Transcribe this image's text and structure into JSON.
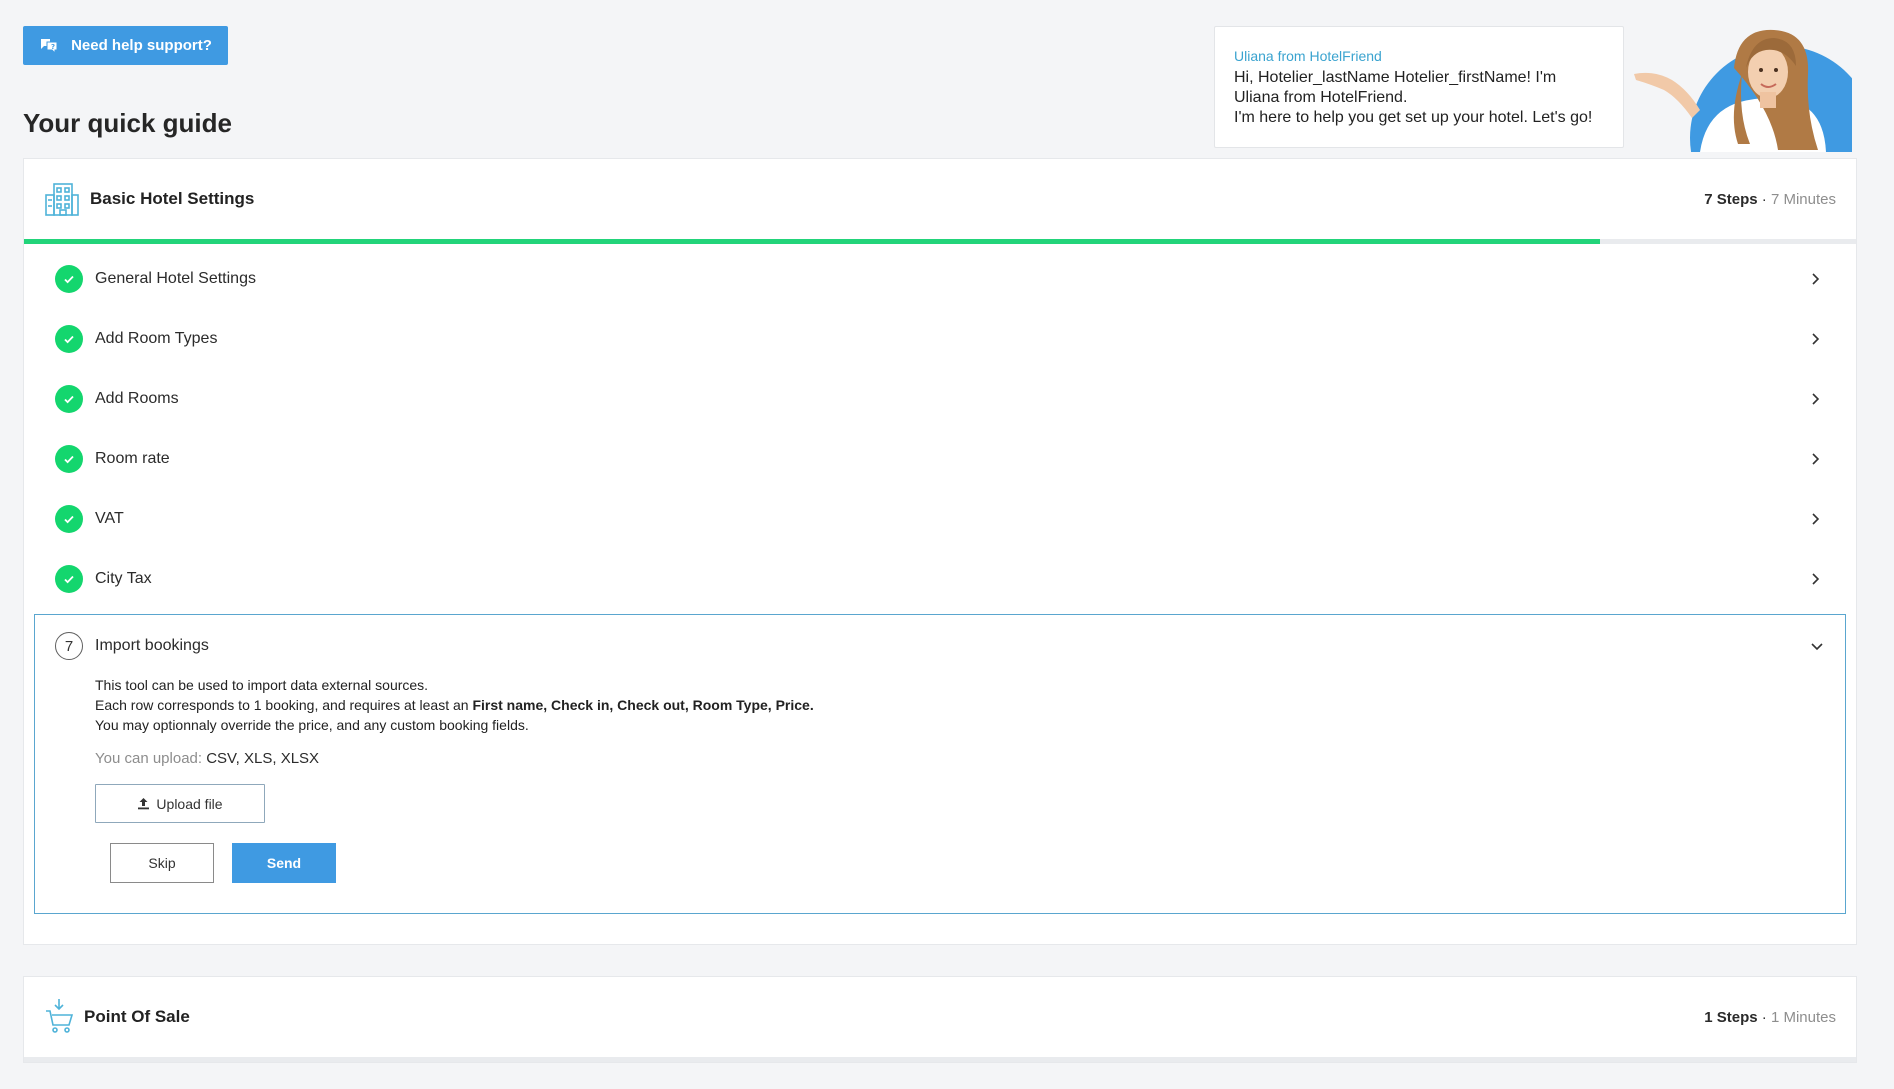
{
  "header": {
    "help_button_label": "Need help support?",
    "page_title": "Your quick guide"
  },
  "chat": {
    "sender": "Uliana from HotelFriend",
    "lines": [
      "Hi, Hotelier_lastName Hotelier_firstName! I'm",
      "Uliana from HotelFriend.",
      "I'm here to help you get set up your hotel. Let's go!"
    ]
  },
  "basic_settings": {
    "title": "Basic Hotel Settings",
    "steps_count": "7 Steps",
    "separator": " · ",
    "minutes": "7 Minutes",
    "progress_fraction": 0.86,
    "steps": [
      {
        "label": "General Hotel Settings",
        "done": true
      },
      {
        "label": "Add Room Types",
        "done": true
      },
      {
        "label": "Add Rooms",
        "done": true
      },
      {
        "label": "Room rate",
        "done": true
      },
      {
        "label": "VAT",
        "done": true
      },
      {
        "label": "City Tax",
        "done": true
      }
    ],
    "open_step": {
      "number": "7",
      "label": "Import bookings",
      "desc_line1": "This tool can be used to import data external sources.",
      "desc_line2_prefix": "Each row corresponds to 1 booking, and requires at least an ",
      "desc_line2_bold": "First name, Check in, Check out, Room Type, Price.",
      "desc_line3": "You may optionnaly override the price, and any custom booking fields.",
      "upload_note_label": "You can upload: ",
      "upload_note_formats": "CSV, XLS, XLSX",
      "upload_button": "Upload file",
      "skip_button": "Skip",
      "send_button": "Send"
    }
  },
  "point_of_sale": {
    "title": "Point Of Sale",
    "steps_count": "1 Steps",
    "separator": " · ",
    "minutes": "1 Minutes"
  },
  "colors": {
    "accent": "#3f9ae2",
    "progress": "#22d47a",
    "check": "#14d66e",
    "chat_sender": "#3aa3cf"
  }
}
